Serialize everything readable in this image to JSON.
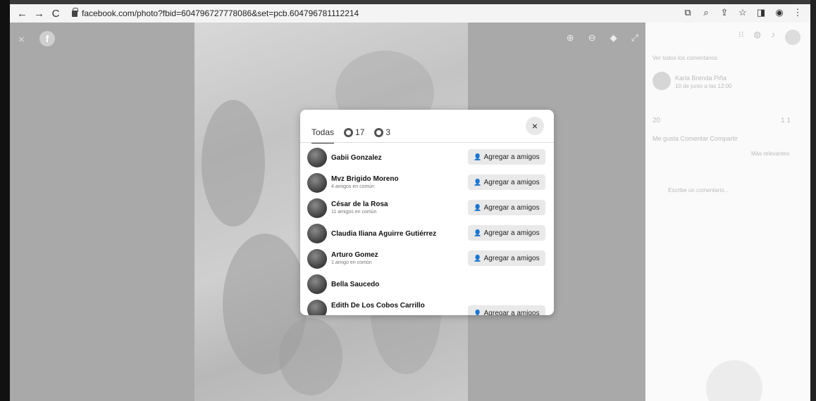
{
  "browser": {
    "url": "facebook.com/photo?fbid=604796727778086&set=pcb.604796781112214",
    "nav": {
      "back": "←",
      "forward": "→",
      "reload": "C"
    },
    "icons": [
      "screenshot-icon",
      "zoom-icon",
      "share-icon",
      "star-icon",
      "sidepanel-icon",
      "profile-icon",
      "menu-icon"
    ]
  },
  "viewer": {
    "close": "×",
    "brand": "f",
    "tools": [
      "zoom-in-icon",
      "zoom-out-icon",
      "tag-icon",
      "fullscreen-icon"
    ]
  },
  "sidebar": {
    "line1": "Ver todos los comentarios",
    "line2": "Karla Brenda Piña",
    "line3": "10 de junio a las 12:00",
    "reactions": "20",
    "counts": "1  1",
    "actions": "Me gusta    Comentar    Compartir",
    "relevant": "Más relevantes",
    "comment_hint": "Escribe un comentario..."
  },
  "modal": {
    "tabs": [
      {
        "label": "Todas",
        "active": true
      },
      {
        "label": "17",
        "icon": "like-reaction-icon"
      },
      {
        "label": "3",
        "icon": "love-reaction-icon"
      }
    ],
    "close": "×",
    "add_label": "Agregar a amigos",
    "people": [
      {
        "name": "Gabii Gonzalez",
        "sub": "",
        "button": true
      },
      {
        "name": "Mvz Brigido Moreno",
        "sub": "4 amigos en común",
        "button": true
      },
      {
        "name": "César de la Rosa",
        "sub": "11 amigos en común",
        "button": true
      },
      {
        "name": "Claudia Iliana Aguirre Gutiérrez",
        "sub": "",
        "button": true
      },
      {
        "name": "Arturo Gomez",
        "sub": "1 amigo en común",
        "button": true
      },
      {
        "name": "Bella Saucedo",
        "sub": "",
        "button": false
      },
      {
        "name": "Edith De Los Cobos Carrillo",
        "sub": "",
        "button": true
      }
    ]
  }
}
